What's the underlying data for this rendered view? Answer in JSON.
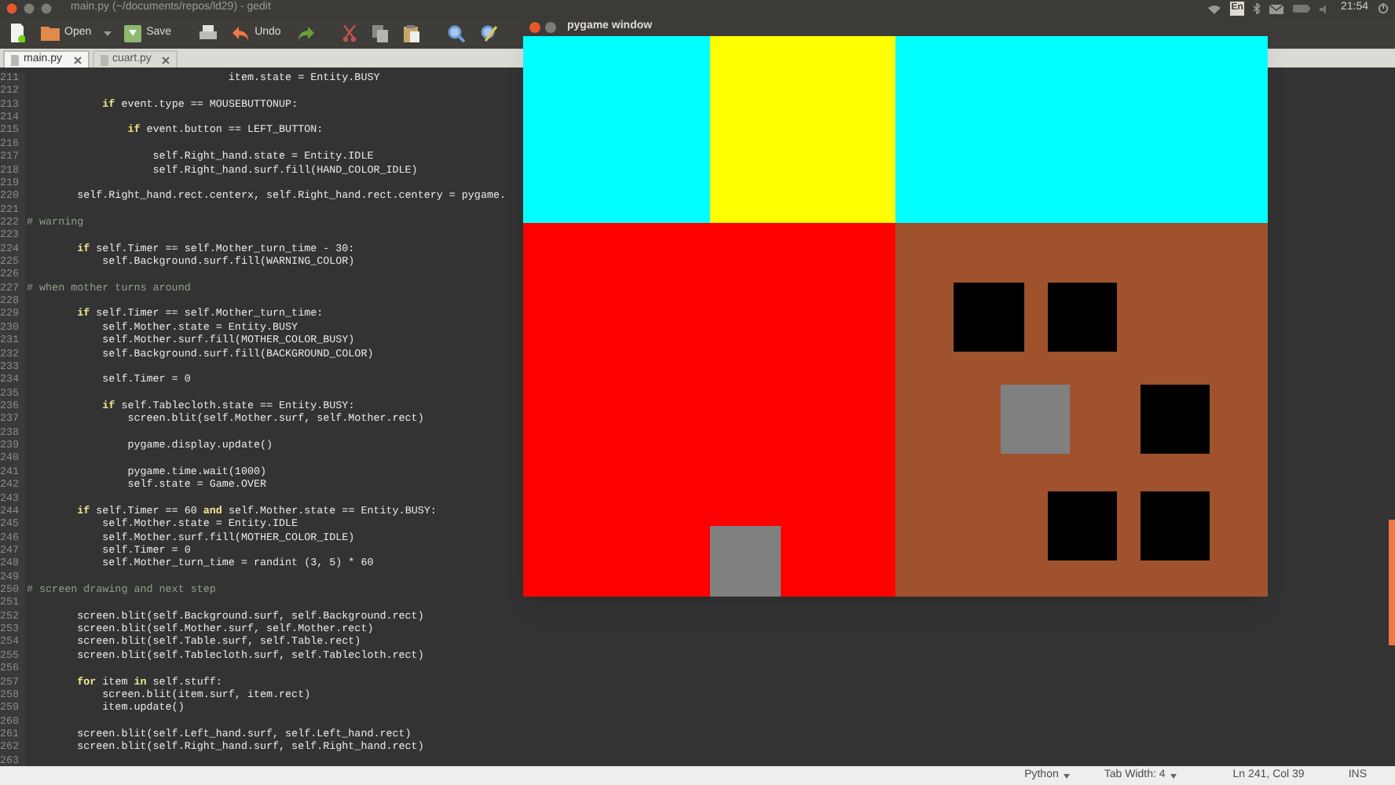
{
  "top_panel": {
    "title": "main.py (~/documents/repos/ld29) - gedit",
    "keyboard": "En",
    "clock": "21:54"
  },
  "toolbar": [
    {
      "kind": "new"
    },
    {
      "kind": "open",
      "label": "Open"
    },
    {
      "kind": "save",
      "label": "Save"
    },
    {
      "kind": "print"
    },
    {
      "kind": "undo",
      "label": "Undo"
    },
    {
      "kind": "redo"
    },
    {
      "kind": "cut"
    },
    {
      "kind": "copy"
    },
    {
      "kind": "paste"
    },
    {
      "kind": "search"
    },
    {
      "kind": "replace"
    }
  ],
  "tabs": [
    {
      "label": "main.py",
      "selected": true
    },
    {
      "label": "cuart.py",
      "selected": false
    }
  ],
  "editor": {
    "lines": [
      {
        "number": "211",
        "kind": "code",
        "text": "                                item.state = Entity.BUSY"
      },
      {
        "number": "212",
        "kind": "blank"
      },
      {
        "number": "213",
        "kind": "code",
        "text": "            **if** event.type == MOUSEBUTTONUP:"
      },
      {
        "number": "214",
        "kind": "blank"
      },
      {
        "number": "215",
        "kind": "code",
        "text": "                **if** event.button == LEFT_BUTTON:"
      },
      {
        "number": "216",
        "kind": "blank"
      },
      {
        "number": "217",
        "kind": "code",
        "text": "                    self.Right_hand.state = Entity.IDLE"
      },
      {
        "number": "218",
        "kind": "code",
        "text": "                    self.Right_hand.surf.fill(HAND_COLOR_IDLE)"
      },
      {
        "number": "219",
        "kind": "blank"
      },
      {
        "number": "220",
        "kind": "code",
        "text": "        self.Right_hand.rect.centerx, self.Right_hand.rect.centery = pygame."
      },
      {
        "number": "221",
        "kind": "blank"
      },
      {
        "number": "222",
        "kind": "comment",
        "text": "# warning"
      },
      {
        "number": "223",
        "kind": "blank"
      },
      {
        "number": "224",
        "kind": "code",
        "text": "        **if** self.Timer == self.Mother_turn_time - 30:"
      },
      {
        "number": "225",
        "kind": "code",
        "text": "            self.Background.surf.fill(WARNING_COLOR)"
      },
      {
        "number": "226",
        "kind": "blank"
      },
      {
        "number": "227",
        "kind": "comment",
        "text": "# when mother turns around"
      },
      {
        "number": "228",
        "kind": "blank"
      },
      {
        "number": "229",
        "kind": "code",
        "text": "        **if** self.Timer == self.Mother_turn_time:"
      },
      {
        "number": "230",
        "kind": "code",
        "text": "            self.Mother.state = Entity.BUSY"
      },
      {
        "number": "231",
        "kind": "code",
        "text": "            self.Mother.surf.fill(MOTHER_COLOR_BUSY)"
      },
      {
        "number": "232",
        "kind": "code",
        "text": "            self.Background.surf.fill(BACKGROUND_COLOR)"
      },
      {
        "number": "233",
        "kind": "blank"
      },
      {
        "number": "234",
        "kind": "code",
        "text": "            self.Timer = 0"
      },
      {
        "number": "235",
        "kind": "blank"
      },
      {
        "number": "236",
        "kind": "code",
        "text": "            **if** self.Tablecloth.state == Entity.BUSY:"
      },
      {
        "number": "237",
        "kind": "code",
        "text": "                screen.blit(self.Mother.surf, self.Mother.rect)"
      },
      {
        "number": "238",
        "kind": "blank"
      },
      {
        "number": "239",
        "kind": "code",
        "text": "                pygame.display.update()"
      },
      {
        "number": "240",
        "kind": "blank"
      },
      {
        "number": "241",
        "kind": "code",
        "text": "                pygame.time.wait(1000)"
      },
      {
        "number": "242",
        "kind": "code",
        "text": "                self.state = Game.OVER"
      },
      {
        "number": "243",
        "kind": "blank"
      },
      {
        "number": "244",
        "kind": "code",
        "text": "        **if** self.Timer == 60 **and** self.Mother.state == Entity.BUSY:"
      },
      {
        "number": "245",
        "kind": "code",
        "text": "            self.Mother.state = Entity.IDLE"
      },
      {
        "number": "246",
        "kind": "code",
        "text": "            self.Mother.surf.fill(MOTHER_COLOR_IDLE)"
      },
      {
        "number": "247",
        "kind": "code",
        "text": "            self.Timer = 0"
      },
      {
        "number": "248",
        "kind": "code",
        "text": "            self.Mother_turn_time = randint (3, 5) * 60"
      },
      {
        "number": "249",
        "kind": "blank"
      },
      {
        "number": "250",
        "kind": "comment",
        "text": "# screen drawing and next step"
      },
      {
        "number": "251",
        "kind": "blank"
      },
      {
        "number": "252",
        "kind": "code",
        "text": "        screen.blit(self.Background.surf, self.Background.rect)"
      },
      {
        "number": "253",
        "kind": "code",
        "text": "        screen.blit(self.Mother.surf, self.Mother.rect)"
      },
      {
        "number": "254",
        "kind": "code",
        "text": "        screen.blit(self.Table.surf, self.Table.rect)"
      },
      {
        "number": "255",
        "kind": "code",
        "text": "        screen.blit(self.Tablecloth.surf, self.Tablecloth.rect)"
      },
      {
        "number": "256",
        "kind": "blank"
      },
      {
        "number": "257",
        "kind": "code",
        "text": "        **for** item **in** self.stuff:"
      },
      {
        "number": "258",
        "kind": "code",
        "text": "            screen.blit(item.surf, item.rect)"
      },
      {
        "number": "259",
        "kind": "code",
        "text": "            item.update()"
      },
      {
        "number": "260",
        "kind": "blank"
      },
      {
        "number": "261",
        "kind": "code",
        "text": "        screen.blit(self.Left_hand.surf, self.Left_hand.rect)"
      },
      {
        "number": "262",
        "kind": "code",
        "text": "        screen.blit(self.Right_hand.surf, self.Right_hand.rect)"
      },
      {
        "number": "263",
        "kind": "blank"
      }
    ]
  },
  "pygame_window": {
    "title": "pygame window"
  },
  "status_bar": {
    "language": "Python",
    "tab_width": "Tab Width: 4",
    "position": "Ln 241, Col 39",
    "mode": "INS"
  }
}
